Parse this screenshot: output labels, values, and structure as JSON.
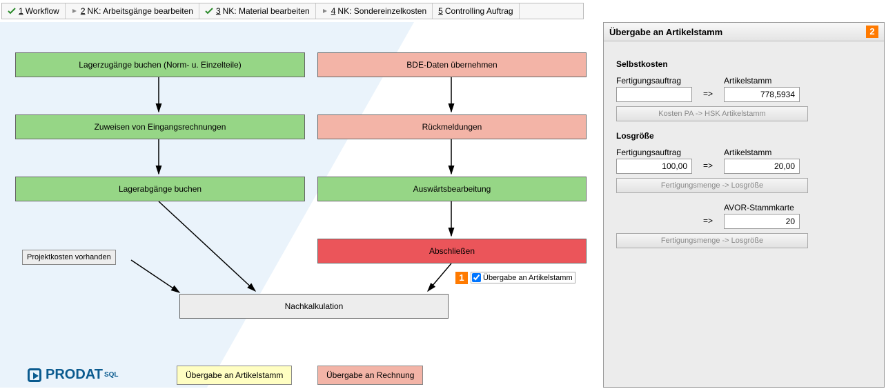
{
  "topnav": [
    {
      "icon": "check",
      "num": "1",
      "label": "Workflow"
    },
    {
      "icon": "tri",
      "num": "2",
      "label": "NK: Arbeitsgänge bearbeiten"
    },
    {
      "icon": "check",
      "num": "3",
      "label": "NK: Material bearbeiten"
    },
    {
      "icon": "tri",
      "num": "4",
      "label": "NK: Sondereinzelkosten"
    },
    {
      "icon": "",
      "num": "5",
      "label": "Controlling Auftrag"
    }
  ],
  "boxes": {
    "lager_zu": "Lagerzugänge buchen (Norm- u. Einzelteile)",
    "zuweisen": "Zuweisen von Eingangsrechnungen",
    "lager_ab": "Lagerabgänge buchen",
    "bde": "BDE-Daten übernehmen",
    "rueck": "Rückmeldungen",
    "ausw": "Auswärtsbearbeitung",
    "abschl": "Abschließen",
    "nk": "Nachkalkulation",
    "proj": "Projektkosten vorhanden"
  },
  "checkbox": {
    "label": "Übergabe an Artikelstamm",
    "checked": true
  },
  "markers": {
    "one": "1",
    "two": "2"
  },
  "legend": {
    "yellow": "Übergabe an Artikelstamm",
    "pink": "Übergabe an Rechnung"
  },
  "logo": {
    "name": "PRODAT",
    "suffix": "SQL"
  },
  "panel": {
    "title": "Übergabe an Artikelstamm",
    "selbstkosten": {
      "heading": "Selbstkosten",
      "fa_label": "Fertigungsauftrag",
      "fa_value": "",
      "as_label": "Artikelstamm",
      "as_value": "778,5934",
      "btn": "Kosten PA -> HSK Artikelstamm"
    },
    "losgroesse": {
      "heading": "Losgröße",
      "fa_label": "Fertigungsauftrag",
      "fa_value": "100,00",
      "as_label": "Artikelstamm",
      "as_value": "20,00",
      "btn1": "Fertigungsmenge -> Losgröße",
      "avor_label": "AVOR-Stammkarte",
      "avor_value": "20",
      "btn2": "Fertigungsmenge -> Losgröße"
    },
    "arrow": "=>"
  }
}
